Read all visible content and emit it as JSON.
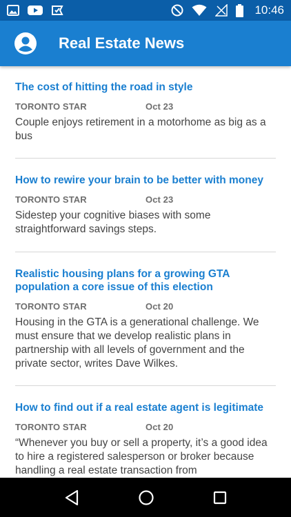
{
  "status_bar": {
    "time": "10:46"
  },
  "app_bar": {
    "title": "Real Estate News"
  },
  "articles": [
    {
      "title": "The cost of hitting the road in style",
      "source": "TORONTO STAR",
      "date": "Oct 23",
      "summary": "Couple enjoys retirement in a motorhome as big as a bus"
    },
    {
      "title": "How to rewire your brain to be better with money",
      "source": "TORONTO STAR",
      "date": "Oct 23",
      "summary": "Sidestep your cognitive biases with some straightforward savings steps."
    },
    {
      "title": "Realistic housing plans for a growing GTA population a core issue of this election",
      "source": "TORONTO STAR",
      "date": "Oct 20",
      "summary": "Housing in the GTA is a generational challenge. We must ensure that we develop realistic plans in partnership with all levels of government and the private sector, writes Dave Wilkes."
    },
    {
      "title": "How to find out if a real estate agent is legitimate",
      "source": "TORONTO STAR",
      "date": "Oct 20",
      "summary": "“Whenever you buy or sell a property, it’s a good idea to hire a registered salesperson or broker because handling a real estate transaction from"
    }
  ]
}
